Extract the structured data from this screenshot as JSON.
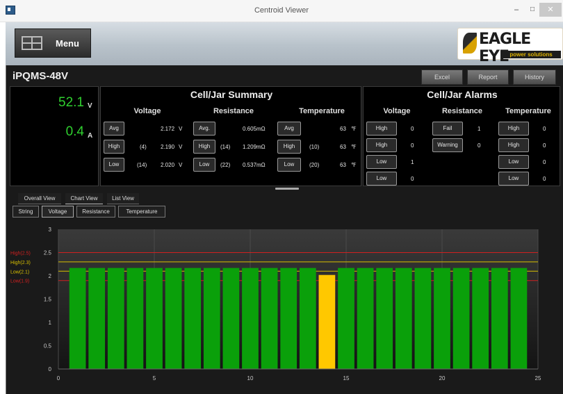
{
  "window": {
    "title": "Centroid Viewer",
    "min": "–",
    "max": "□",
    "close": "✕"
  },
  "header": {
    "menu_label": "Menu",
    "logo_text": "EAGLE EYE",
    "logo_sub": "power solutions"
  },
  "device": {
    "name": "iPQMS-48V",
    "voltage": "52.1",
    "voltage_unit": "V",
    "current": "0.4",
    "current_unit": "A"
  },
  "toolbar": {
    "excel": "Excel",
    "report": "Report",
    "history": "History"
  },
  "summary": {
    "title": "Cell/Jar Summary",
    "headers": {
      "voltage": "Voltage",
      "resistance": "Resistance",
      "temperature": "Temperature"
    },
    "rows": [
      {
        "v_btn": "Avg",
        "v_idx": "",
        "v_val": "2.172",
        "v_unit": "V",
        "r_btn": "Avg.",
        "r_idx": "",
        "r_val": "0.605",
        "r_unit": "mΩ",
        "t_btn": "Avg",
        "t_idx": "",
        "t_val": "63",
        "t_unit": "℉"
      },
      {
        "v_btn": "High",
        "v_idx": "(4)",
        "v_val": "2.190",
        "v_unit": "V",
        "r_btn": "High",
        "r_idx": "(14)",
        "r_val": "1.209",
        "r_unit": "mΩ",
        "t_btn": "High",
        "t_idx": "(10)",
        "t_val": "63",
        "t_unit": "℉"
      },
      {
        "v_btn": "Low",
        "v_idx": "(14)",
        "v_val": "2.020",
        "v_unit": "V",
        "r_btn": "Low",
        "r_idx": "(22)",
        "r_val": "0.537",
        "r_unit": "mΩ",
        "t_btn": "Low",
        "t_idx": "(20)",
        "t_val": "63",
        "t_unit": "℉"
      }
    ]
  },
  "alarms": {
    "title": "Cell/Jar Alarms",
    "headers": {
      "voltage": "Voltage",
      "resistance": "Resistance",
      "temperature": "Temperature"
    },
    "voltage": [
      {
        "label": "High",
        "count": "0"
      },
      {
        "label": "High",
        "count": "0"
      },
      {
        "label": "Low",
        "count": "1"
      },
      {
        "label": "Low",
        "count": "0"
      }
    ],
    "resistance": [
      {
        "label": "Fail",
        "count": "1"
      },
      {
        "label": "Warning",
        "count": "0"
      }
    ],
    "temperature": [
      {
        "label": "High",
        "count": "0"
      },
      {
        "label": "High",
        "count": "0"
      },
      {
        "label": "Low",
        "count": "0"
      },
      {
        "label": "Low",
        "count": "0"
      }
    ]
  },
  "view_tabs": [
    "Overall View",
    "Chart View",
    "List View"
  ],
  "sub_tabs": [
    "String",
    "Voltage",
    "Resistance",
    "Temperature"
  ],
  "chart_data": {
    "type": "bar",
    "x": [
      1,
      2,
      3,
      4,
      5,
      6,
      7,
      8,
      9,
      10,
      11,
      12,
      13,
      14,
      15,
      16,
      17,
      18,
      19,
      20,
      21,
      22,
      23,
      24
    ],
    "values": [
      2.17,
      2.17,
      2.17,
      2.17,
      2.17,
      2.17,
      2.17,
      2.17,
      2.17,
      2.17,
      2.17,
      2.17,
      2.17,
      2.02,
      2.17,
      2.17,
      2.17,
      2.17,
      2.17,
      2.17,
      2.17,
      2.17,
      2.17,
      2.17
    ],
    "highlight_index": 13,
    "bar_color": "#0aa00a",
    "highlight_color": "#ffc800",
    "xlim": [
      0,
      25
    ],
    "ylim": [
      0,
      3
    ],
    "xticks": [
      "0",
      "5",
      "10",
      "15",
      "20",
      "25"
    ],
    "yticks": [
      "3",
      "2.5",
      "2",
      "1.5",
      "1",
      "0.5",
      "0"
    ],
    "thresholds": [
      {
        "label": "High(2.5)",
        "value": 2.5,
        "color": "#d02020"
      },
      {
        "label": "High(2.3)",
        "value": 2.3,
        "color": "#d8c000"
      },
      {
        "label": "Low(2.1)",
        "value": 2.1,
        "color": "#d8c000"
      },
      {
        "label": "Low(1.9)",
        "value": 1.9,
        "color": "#d02020"
      }
    ]
  }
}
